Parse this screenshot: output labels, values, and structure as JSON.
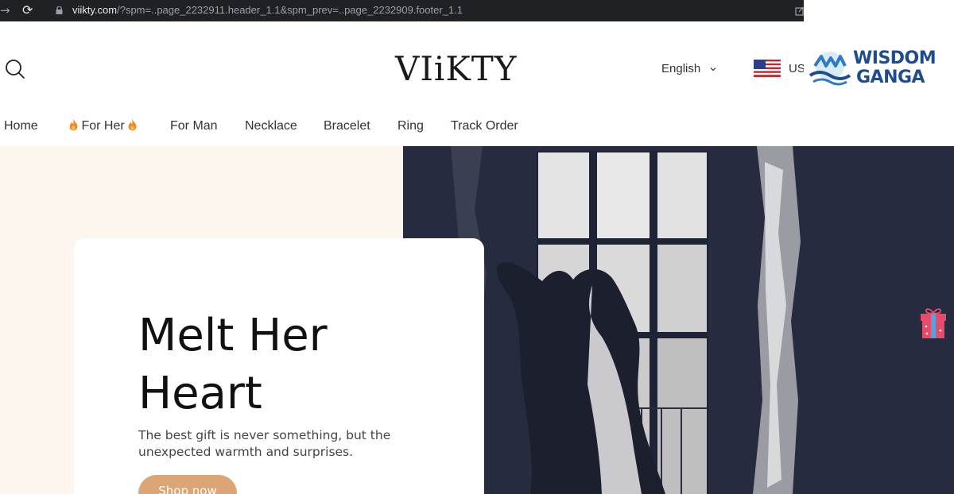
{
  "browser": {
    "url_host": "viikty.com",
    "url_rest": "/?spm=..page_2232911.header_1.1&spm_prev=..page_2232909.footer_1.1"
  },
  "header": {
    "logo": "VIiKTY",
    "language": "English",
    "country": "US"
  },
  "watermark": {
    "line1": "WISDOM",
    "line2": "GANGA"
  },
  "nav": {
    "items": [
      {
        "label": "Home"
      },
      {
        "label": "For Her"
      },
      {
        "label": "For Man"
      },
      {
        "label": "Necklace"
      },
      {
        "label": "Bracelet"
      },
      {
        "label": "Ring"
      },
      {
        "label": "Track Order"
      }
    ]
  },
  "hero": {
    "headline_line1": "Melt Her",
    "headline_line2": "Heart",
    "subtext": "The best gift is never something, but the unexpected warmth and surprises.",
    "button_label": "Shop now"
  },
  "colors": {
    "accent": "#dba576",
    "hero_left_bg": "#fdf6ee",
    "hero_photo_bg": "#262b40",
    "watermark_blue": "#1e4c8c"
  }
}
